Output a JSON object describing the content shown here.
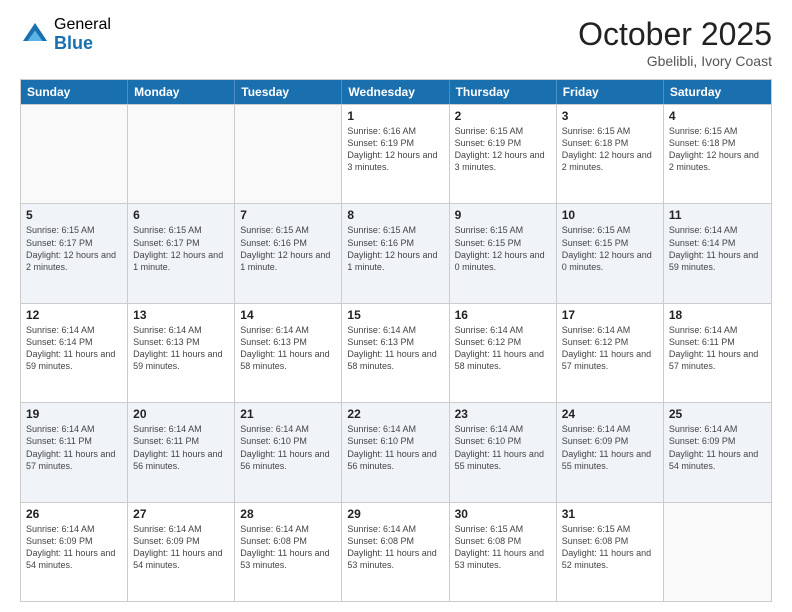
{
  "header": {
    "logo_general": "General",
    "logo_blue": "Blue",
    "month_title": "October 2025",
    "location": "Gbelibli, Ivory Coast"
  },
  "weekdays": [
    "Sunday",
    "Monday",
    "Tuesday",
    "Wednesday",
    "Thursday",
    "Friday",
    "Saturday"
  ],
  "rows": [
    {
      "alt": false,
      "cells": [
        {
          "day": "",
          "info": ""
        },
        {
          "day": "",
          "info": ""
        },
        {
          "day": "",
          "info": ""
        },
        {
          "day": "1",
          "info": "Sunrise: 6:16 AM\nSunset: 6:19 PM\nDaylight: 12 hours and 3 minutes."
        },
        {
          "day": "2",
          "info": "Sunrise: 6:15 AM\nSunset: 6:19 PM\nDaylight: 12 hours and 3 minutes."
        },
        {
          "day": "3",
          "info": "Sunrise: 6:15 AM\nSunset: 6:18 PM\nDaylight: 12 hours and 2 minutes."
        },
        {
          "day": "4",
          "info": "Sunrise: 6:15 AM\nSunset: 6:18 PM\nDaylight: 12 hours and 2 minutes."
        }
      ]
    },
    {
      "alt": true,
      "cells": [
        {
          "day": "5",
          "info": "Sunrise: 6:15 AM\nSunset: 6:17 PM\nDaylight: 12 hours and 2 minutes."
        },
        {
          "day": "6",
          "info": "Sunrise: 6:15 AM\nSunset: 6:17 PM\nDaylight: 12 hours and 1 minute."
        },
        {
          "day": "7",
          "info": "Sunrise: 6:15 AM\nSunset: 6:16 PM\nDaylight: 12 hours and 1 minute."
        },
        {
          "day": "8",
          "info": "Sunrise: 6:15 AM\nSunset: 6:16 PM\nDaylight: 12 hours and 1 minute."
        },
        {
          "day": "9",
          "info": "Sunrise: 6:15 AM\nSunset: 6:15 PM\nDaylight: 12 hours and 0 minutes."
        },
        {
          "day": "10",
          "info": "Sunrise: 6:15 AM\nSunset: 6:15 PM\nDaylight: 12 hours and 0 minutes."
        },
        {
          "day": "11",
          "info": "Sunrise: 6:14 AM\nSunset: 6:14 PM\nDaylight: 11 hours and 59 minutes."
        }
      ]
    },
    {
      "alt": false,
      "cells": [
        {
          "day": "12",
          "info": "Sunrise: 6:14 AM\nSunset: 6:14 PM\nDaylight: 11 hours and 59 minutes."
        },
        {
          "day": "13",
          "info": "Sunrise: 6:14 AM\nSunset: 6:13 PM\nDaylight: 11 hours and 59 minutes."
        },
        {
          "day": "14",
          "info": "Sunrise: 6:14 AM\nSunset: 6:13 PM\nDaylight: 11 hours and 58 minutes."
        },
        {
          "day": "15",
          "info": "Sunrise: 6:14 AM\nSunset: 6:13 PM\nDaylight: 11 hours and 58 minutes."
        },
        {
          "day": "16",
          "info": "Sunrise: 6:14 AM\nSunset: 6:12 PM\nDaylight: 11 hours and 58 minutes."
        },
        {
          "day": "17",
          "info": "Sunrise: 6:14 AM\nSunset: 6:12 PM\nDaylight: 11 hours and 57 minutes."
        },
        {
          "day": "18",
          "info": "Sunrise: 6:14 AM\nSunset: 6:11 PM\nDaylight: 11 hours and 57 minutes."
        }
      ]
    },
    {
      "alt": true,
      "cells": [
        {
          "day": "19",
          "info": "Sunrise: 6:14 AM\nSunset: 6:11 PM\nDaylight: 11 hours and 57 minutes."
        },
        {
          "day": "20",
          "info": "Sunrise: 6:14 AM\nSunset: 6:11 PM\nDaylight: 11 hours and 56 minutes."
        },
        {
          "day": "21",
          "info": "Sunrise: 6:14 AM\nSunset: 6:10 PM\nDaylight: 11 hours and 56 minutes."
        },
        {
          "day": "22",
          "info": "Sunrise: 6:14 AM\nSunset: 6:10 PM\nDaylight: 11 hours and 56 minutes."
        },
        {
          "day": "23",
          "info": "Sunrise: 6:14 AM\nSunset: 6:10 PM\nDaylight: 11 hours and 55 minutes."
        },
        {
          "day": "24",
          "info": "Sunrise: 6:14 AM\nSunset: 6:09 PM\nDaylight: 11 hours and 55 minutes."
        },
        {
          "day": "25",
          "info": "Sunrise: 6:14 AM\nSunset: 6:09 PM\nDaylight: 11 hours and 54 minutes."
        }
      ]
    },
    {
      "alt": false,
      "cells": [
        {
          "day": "26",
          "info": "Sunrise: 6:14 AM\nSunset: 6:09 PM\nDaylight: 11 hours and 54 minutes."
        },
        {
          "day": "27",
          "info": "Sunrise: 6:14 AM\nSunset: 6:09 PM\nDaylight: 11 hours and 54 minutes."
        },
        {
          "day": "28",
          "info": "Sunrise: 6:14 AM\nSunset: 6:08 PM\nDaylight: 11 hours and 53 minutes."
        },
        {
          "day": "29",
          "info": "Sunrise: 6:14 AM\nSunset: 6:08 PM\nDaylight: 11 hours and 53 minutes."
        },
        {
          "day": "30",
          "info": "Sunrise: 6:15 AM\nSunset: 6:08 PM\nDaylight: 11 hours and 53 minutes."
        },
        {
          "day": "31",
          "info": "Sunrise: 6:15 AM\nSunset: 6:08 PM\nDaylight: 11 hours and 52 minutes."
        },
        {
          "day": "",
          "info": ""
        }
      ]
    }
  ]
}
